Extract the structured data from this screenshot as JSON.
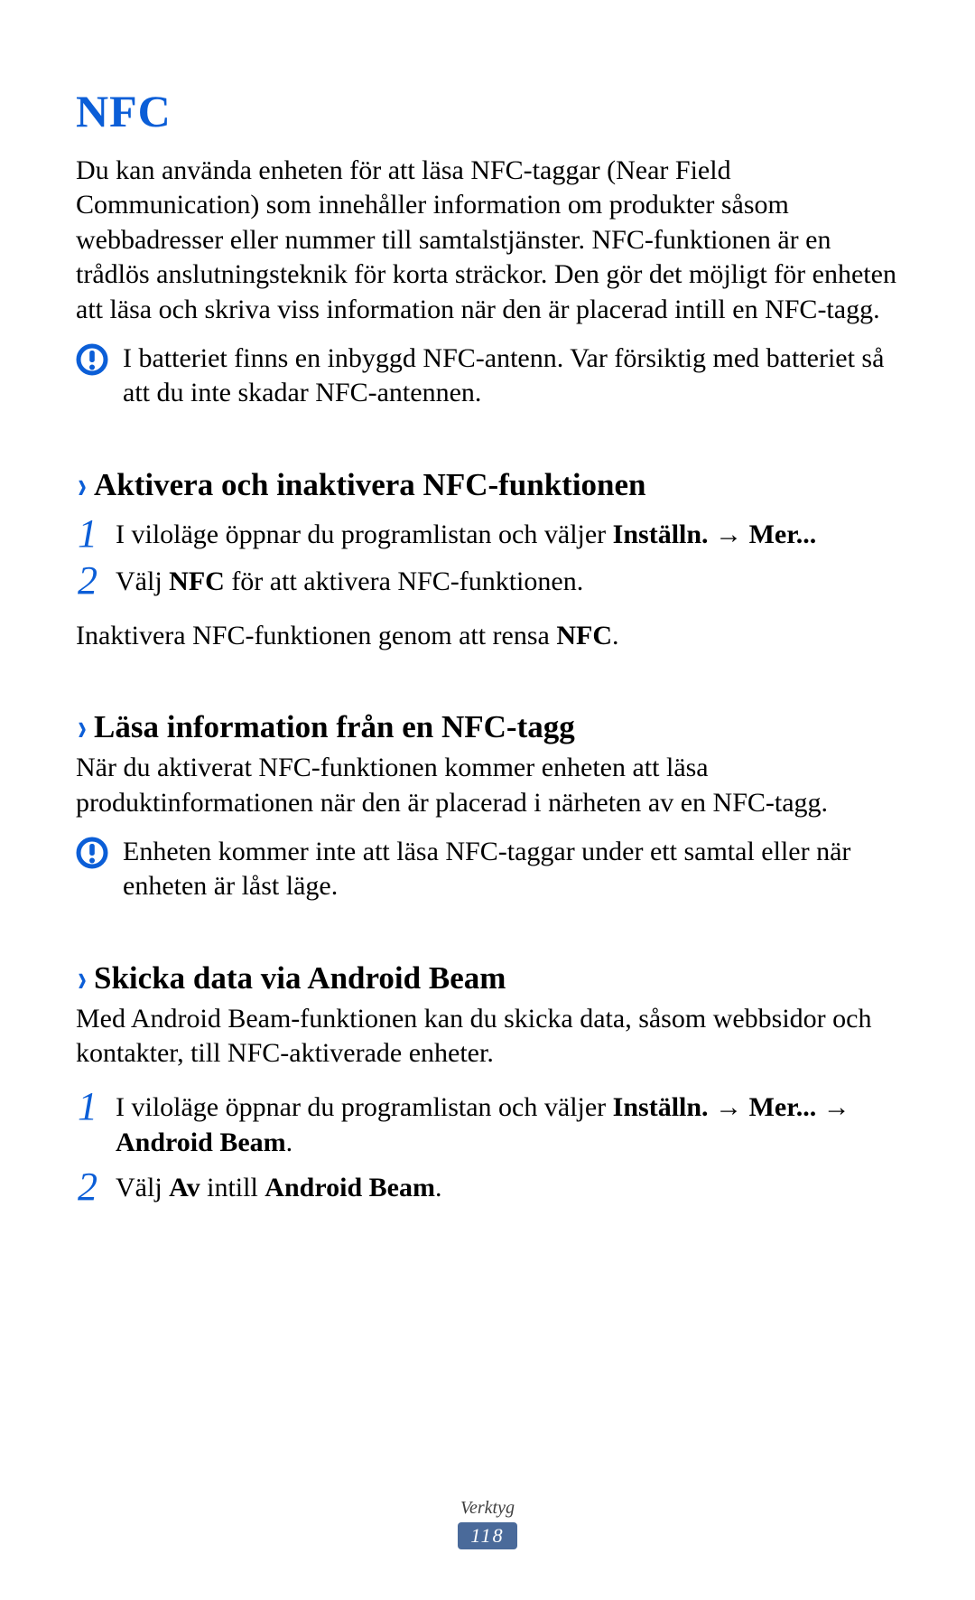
{
  "title": "NFC",
  "intro": "Du kan använda enheten för att läsa NFC-taggar (Near Field Communication) som innehåller information om produkter såsom webbadresser eller nummer till samtalstjänster. NFC-funktionen är en trådlös anslutningsteknik för korta sträckor. Den gör det möjligt för enheten att läsa och skriva viss information när den är placerad intill en NFC-tagg.",
  "note1": "I batteriet finns en inbyggd NFC-antenn. Var försiktig med batteriet så att du inte skadar NFC-antennen.",
  "section1": {
    "heading": "Aktivera och inaktivera NFC-funktionen",
    "step1_pre": "I viloläge öppnar du programlistan och väljer ",
    "step1_b1": "Inställn.",
    "step1_arrow": " → ",
    "step1_b2": "Mer...",
    "step2_pre": "Välj ",
    "step2_b1": "NFC",
    "step2_post": " för att aktivera NFC-funktionen.",
    "after_pre": "Inaktivera NFC-funktionen genom att rensa ",
    "after_b": "NFC",
    "after_post": "."
  },
  "section2": {
    "heading": "Läsa information från en NFC-tagg",
    "body": "När du aktiverat NFC-funktionen kommer enheten att läsa produktinformationen när den är placerad i närheten av en NFC-tagg.",
    "note": "Enheten kommer inte att läsa NFC-taggar under ett samtal eller när enheten är låst läge."
  },
  "section3": {
    "heading": "Skicka data via Android Beam",
    "body": "Med Android Beam-funktionen kan du skicka data, såsom webbsidor och kontakter, till NFC-aktiverade enheter.",
    "step1_pre": "I viloläge öppnar du programlistan och väljer ",
    "step1_b1": "Inställn.",
    "step1_arrow1": " → ",
    "step1_b2": "Mer...",
    "step1_arrow2": " → ",
    "step1_b3": "Android Beam",
    "step1_post": ".",
    "step2_pre": "Välj ",
    "step2_b1": "Av",
    "step2_mid": " intill ",
    "step2_b2": "Android Beam",
    "step2_post": "."
  },
  "footer": {
    "category": "Verktyg",
    "page": "118"
  }
}
